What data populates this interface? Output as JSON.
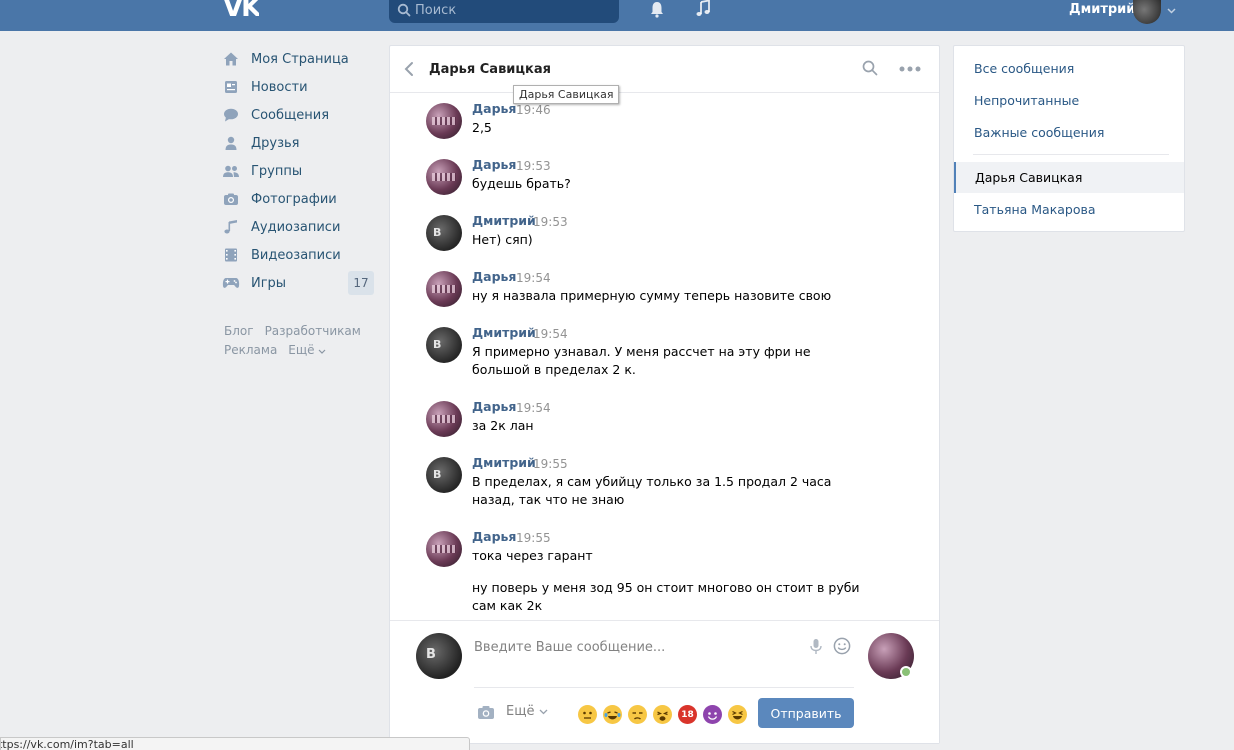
{
  "header": {
    "logo_text": "VK",
    "search_placeholder": "Поиск",
    "user_name": "Дмитрий"
  },
  "leftnav": {
    "items": [
      {
        "label": "Моя Страница",
        "icon": "home-icon"
      },
      {
        "label": "Новости",
        "icon": "news-icon"
      },
      {
        "label": "Сообщения",
        "icon": "messages-icon"
      },
      {
        "label": "Друзья",
        "icon": "friends-icon"
      },
      {
        "label": "Группы",
        "icon": "groups-icon"
      },
      {
        "label": "Фотографии",
        "icon": "camera-icon"
      },
      {
        "label": "Аудиозаписи",
        "icon": "music-icon"
      },
      {
        "label": "Видеозаписи",
        "icon": "video-icon"
      },
      {
        "label": "Игры",
        "icon": "gamepad-icon",
        "badge": "17"
      }
    ],
    "footer": {
      "blog": "Блог",
      "developers": "Разработчикам",
      "ads": "Реклама",
      "more": "Ещё"
    }
  },
  "chat": {
    "title": "Дарья Савицкая",
    "tooltip": "Дарья Савицкая",
    "messages": [
      {
        "author": "Дарья",
        "time": "19:46",
        "text": "2,5",
        "text2": ""
      },
      {
        "author": "Дарья",
        "time": "19:53",
        "text": "будешь брать?",
        "text2": ""
      },
      {
        "author": "Дмитрий",
        "time": "19:53",
        "text": "Нет) сяп)",
        "text2": ""
      },
      {
        "author": "Дарья",
        "time": "19:54",
        "text": "ну я назвала примерную сумму теперь назовите свою",
        "text2": ""
      },
      {
        "author": "Дмитрий",
        "time": "19:54",
        "text": "Я примерно узнавал. У меня рассчет на эту фри не большой в пределах 2 к.",
        "text2": ""
      },
      {
        "author": "Дарья",
        "time": "19:54",
        "text": "за 2к лан",
        "text2": ""
      },
      {
        "author": "Дмитрий",
        "time": "19:55",
        "text": "В пределах, я сам убийцу только за 1.5 продал 2 часа назад, так что не знаю",
        "text2": ""
      },
      {
        "author": "Дарья",
        "time": "19:55",
        "text": "тока через гарант",
        "text2": "ну поверь у меня зод 95 он стоит многово он стоит в руби сам как 2к"
      }
    ],
    "composer": {
      "placeholder": "Введите Ваше сообщение...",
      "more_label": "Ещё",
      "send_label": "Отправить",
      "emojis": [
        {
          "icon": "neutral-face-emoji",
          "color": "#f7c744"
        },
        {
          "icon": "tears-of-joy-emoji",
          "color": "#f7c744"
        },
        {
          "icon": "unamused-face-emoji",
          "color": "#f7c744"
        },
        {
          "icon": "weary-face-emoji",
          "color": "#f7c744"
        },
        {
          "icon": "no-under-18-emoji",
          "color": "#d9342b",
          "text": "18"
        },
        {
          "icon": "smiling-imp-emoji",
          "color": "#8e44ad"
        },
        {
          "icon": "laughing-face-emoji",
          "color": "#f7c744"
        }
      ]
    }
  },
  "rightpanel": {
    "all_messages": "Все сообщения",
    "unread": "Непрочитанные",
    "important": "Важные сообщения",
    "dialogs": [
      {
        "label": "Дарья Савицкая",
        "active": true
      },
      {
        "label": "Татьяна Макарова",
        "active": false
      }
    ]
  },
  "statusbar": {
    "url": "https://vk.com/im?tab=all"
  },
  "colors": {
    "header": "#4a76a8",
    "link": "#2a5885",
    "author": "#42648b",
    "send_button": "#5b88bd"
  }
}
